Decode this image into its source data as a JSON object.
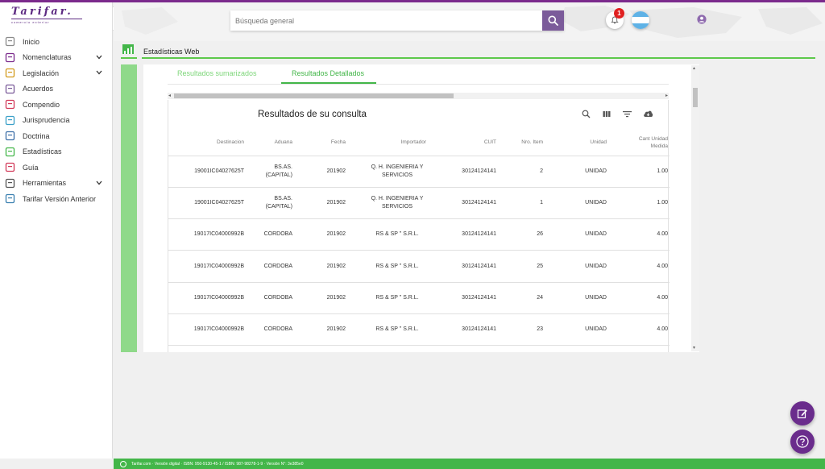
{
  "brand": {
    "logo_text": "Tarifar.",
    "logo_tagline": "comercio exterior"
  },
  "sidebar": {
    "items": [
      {
        "label": "Inicio",
        "icon": "home-icon",
        "has_submenu": false
      },
      {
        "label": "Nomenclaturas",
        "icon": "book-icon",
        "has_submenu": true
      },
      {
        "label": "Legislación",
        "icon": "scales-icon",
        "has_submenu": true
      },
      {
        "label": "Acuerdos",
        "icon": "handshake-icon",
        "has_submenu": false
      },
      {
        "label": "Compendio",
        "icon": "books-icon",
        "has_submenu": false
      },
      {
        "label": "Jurisprudencia",
        "icon": "gavel-icon",
        "has_submenu": false
      },
      {
        "label": "Doctrina",
        "icon": "document-icon",
        "has_submenu": false
      },
      {
        "label": "Estadísticas",
        "icon": "bar-chart-icon",
        "has_submenu": false
      },
      {
        "label": "Guía",
        "icon": "guide-icon",
        "has_submenu": false
      },
      {
        "label": "Herramientas",
        "icon": "wrench-icon",
        "has_submenu": true
      },
      {
        "label": "Tarifar Versión Anterior",
        "icon": "monitor-icon",
        "has_submenu": false
      }
    ]
  },
  "header": {
    "search_placeholder": "Búsqueda general",
    "notification_count": "1"
  },
  "page": {
    "title": "Estadísticas Web"
  },
  "tabs": [
    {
      "label": "Resultados sumarizados",
      "active": false
    },
    {
      "label": "Resultados Detallados",
      "active": true
    }
  ],
  "results": {
    "title": "Resultados de su consulta",
    "toolbar": [
      "search-icon",
      "columns-icon",
      "filter-icon",
      "cloud-download-icon"
    ],
    "columns": [
      "Destinacion",
      "Aduana",
      "Fecha",
      "Importador",
      "CUIT",
      "Nro. Item",
      "Unidad",
      "Cant Unidad Medida"
    ],
    "rows": [
      [
        "19001IC04027625T",
        "BS.AS. (CAPITAL)",
        "201902",
        "Q. H. INGENIERIA Y SERVICIOS",
        "30124124141",
        "2",
        "UNIDAD",
        "1.00"
      ],
      [
        "19001IC04027625T",
        "BS.AS. (CAPITAL)",
        "201902",
        "Q. H. INGENIERIA Y SERVICIOS",
        "30124124141",
        "1",
        "UNIDAD",
        "1.00"
      ],
      [
        "19017IC04000992B",
        "CORDOBA",
        "201902",
        "RS & SP \" S.R.L.",
        "30124124141",
        "26",
        "UNIDAD",
        "4.00"
      ],
      [
        "19017IC04000992B",
        "CORDOBA",
        "201902",
        "RS & SP \" S.R.L.",
        "30124124141",
        "25",
        "UNIDAD",
        "4.00"
      ],
      [
        "19017IC04000992B",
        "CORDOBA",
        "201902",
        "RS & SP \" S.R.L.",
        "30124124141",
        "24",
        "UNIDAD",
        "4.00"
      ],
      [
        "19017IC04000992B",
        "CORDOBA",
        "201902",
        "RS & SP \" S.R.L.",
        "30124124141",
        "23",
        "UNIDAD",
        "4.00"
      ]
    ]
  },
  "footer": {
    "text": "Tarifar.com · Versión digital · ISBN: 950-9130-45-1 / ISBN: 987-98278-1-9 · Versión N°: 3e385e0"
  },
  "colors": {
    "brand_purple": "#6a2c8c",
    "accent_green": "#43b649",
    "tab_inactive": "#7ed67a"
  }
}
